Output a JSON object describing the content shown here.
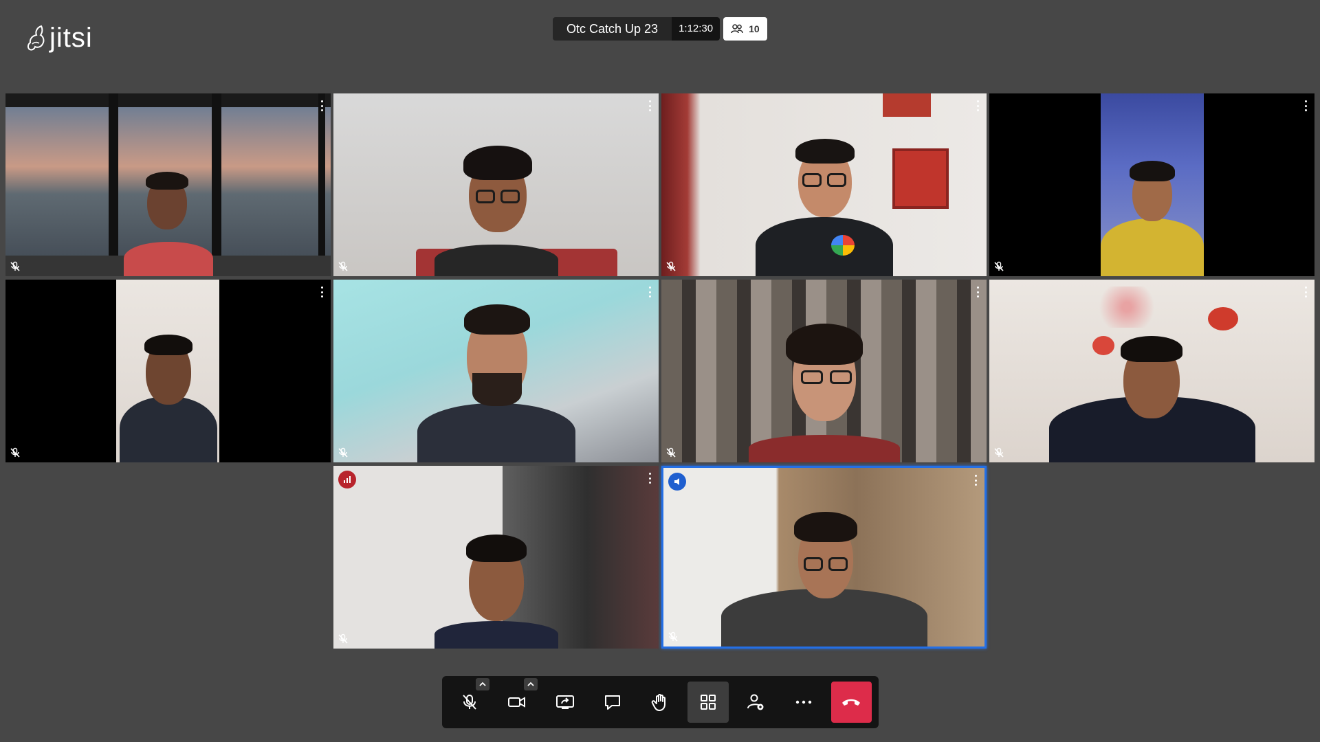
{
  "app": {
    "logo_text": "jitsi"
  },
  "meeting": {
    "title": "Otc Catch Up 23",
    "timer": "1:12:30",
    "participants_count": "10"
  },
  "icons": {
    "logo": "jitsi-mascot-icon",
    "participants": "participants-icon",
    "tile_menu": "more-vertical-icon",
    "tile_muted": "mic-off-icon",
    "connection": "connection-bars-icon",
    "dominant_speaker": "speaker-icon"
  },
  "colors": {
    "background": "#474747",
    "active_border": "#246fe5",
    "hangup": "#dd2c4a",
    "connection_badge": "#b8242c"
  },
  "tiles": [
    {
      "id": 1,
      "muted": true,
      "menu": true
    },
    {
      "id": 2,
      "muted": true,
      "menu": true
    },
    {
      "id": 3,
      "muted": true,
      "menu": true
    },
    {
      "id": 4,
      "muted": true,
      "menu": true
    },
    {
      "id": 5,
      "muted": true,
      "menu": true
    },
    {
      "id": 6,
      "muted": true,
      "menu": true
    },
    {
      "id": 7,
      "muted": true,
      "menu": true
    },
    {
      "id": 8,
      "muted": true,
      "menu": true
    },
    {
      "id": 9,
      "muted": true,
      "menu": true,
      "badge": "connection-bars-icon"
    },
    {
      "id": 10,
      "muted": true,
      "menu": true,
      "badge": "speaker-icon",
      "active_speaker": true
    }
  ],
  "toolbar": {
    "buttons": [
      {
        "name": "microphone-toggle",
        "icon": "mic-off-icon",
        "has_caret": true
      },
      {
        "name": "camera-toggle",
        "icon": "video-camera-icon",
        "has_caret": true
      },
      {
        "name": "screen-share",
        "icon": "screen-share-icon"
      },
      {
        "name": "chat",
        "icon": "chat-icon"
      },
      {
        "name": "raise-hand",
        "icon": "hand-icon"
      },
      {
        "name": "tile-view",
        "icon": "grid-icon",
        "toggled": true
      },
      {
        "name": "participants",
        "icon": "person-add-icon"
      },
      {
        "name": "more-actions",
        "icon": "more-horizontal-icon"
      },
      {
        "name": "leave-meeting",
        "icon": "hangup-icon"
      }
    ]
  }
}
